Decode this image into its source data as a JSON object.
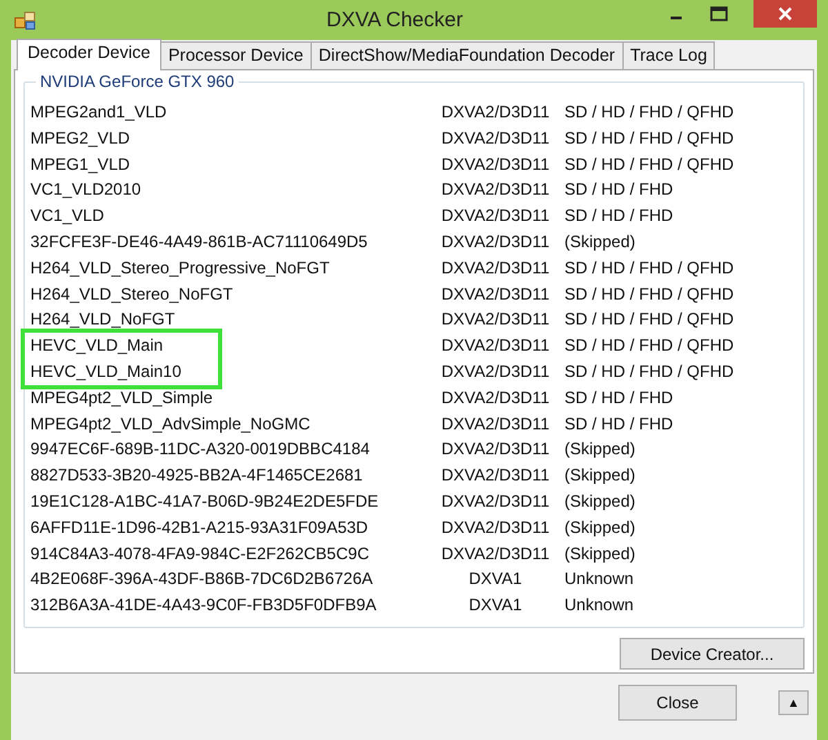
{
  "window": {
    "title": "DXVA Checker"
  },
  "tabs": [
    {
      "label": "Decoder Device",
      "selected": true
    },
    {
      "label": "Processor Device",
      "selected": false
    },
    {
      "label": "DirectShow/MediaFoundation Decoder",
      "selected": false
    },
    {
      "label": "Trace Log",
      "selected": false
    }
  ],
  "group": {
    "title": "NVIDIA GeForce GTX 960"
  },
  "rows": [
    {
      "name": "MPEG2and1_VLD",
      "api": "DXVA2/D3D11",
      "resolutions": "SD / HD / FHD / QFHD",
      "highlighted": false
    },
    {
      "name": "MPEG2_VLD",
      "api": "DXVA2/D3D11",
      "resolutions": "SD / HD / FHD / QFHD",
      "highlighted": false
    },
    {
      "name": "MPEG1_VLD",
      "api": "DXVA2/D3D11",
      "resolutions": "SD / HD / FHD / QFHD",
      "highlighted": false
    },
    {
      "name": "VC1_VLD2010",
      "api": "DXVA2/D3D11",
      "resolutions": "SD / HD / FHD",
      "highlighted": false
    },
    {
      "name": "VC1_VLD",
      "api": "DXVA2/D3D11",
      "resolutions": "SD / HD / FHD",
      "highlighted": false
    },
    {
      "name": "32FCFE3F-DE46-4A49-861B-AC71110649D5",
      "api": "DXVA2/D3D11",
      "resolutions": "(Skipped)",
      "highlighted": false
    },
    {
      "name": "H264_VLD_Stereo_Progressive_NoFGT",
      "api": "DXVA2/D3D11",
      "resolutions": "SD / HD / FHD / QFHD",
      "highlighted": false
    },
    {
      "name": "H264_VLD_Stereo_NoFGT",
      "api": "DXVA2/D3D11",
      "resolutions": "SD / HD / FHD / QFHD",
      "highlighted": false
    },
    {
      "name": "H264_VLD_NoFGT",
      "api": "DXVA2/D3D11",
      "resolutions": "SD / HD / FHD / QFHD",
      "highlighted": false
    },
    {
      "name": "HEVC_VLD_Main",
      "api": "DXVA2/D3D11",
      "resolutions": "SD / HD / FHD / QFHD",
      "highlighted": true
    },
    {
      "name": "HEVC_VLD_Main10",
      "api": "DXVA2/D3D11",
      "resolutions": "SD / HD / FHD / QFHD",
      "highlighted": true
    },
    {
      "name": "MPEG4pt2_VLD_Simple",
      "api": "DXVA2/D3D11",
      "resolutions": "SD / HD / FHD",
      "highlighted": false
    },
    {
      "name": "MPEG4pt2_VLD_AdvSimple_NoGMC",
      "api": "DXVA2/D3D11",
      "resolutions": "SD / HD / FHD",
      "highlighted": false
    },
    {
      "name": "9947EC6F-689B-11DC-A320-0019DBBC4184",
      "api": "DXVA2/D3D11",
      "resolutions": "(Skipped)",
      "highlighted": false
    },
    {
      "name": "8827D533-3B20-4925-BB2A-4F1465CE2681",
      "api": "DXVA2/D3D11",
      "resolutions": "(Skipped)",
      "highlighted": false
    },
    {
      "name": "19E1C128-A1BC-41A7-B06D-9B24E2DE5FDE",
      "api": "DXVA2/D3D11",
      "resolutions": "(Skipped)",
      "highlighted": false
    },
    {
      "name": "6AFFD11E-1D96-42B1-A215-93A31F09A53D",
      "api": "DXVA2/D3D11",
      "resolutions": "(Skipped)",
      "highlighted": false
    },
    {
      "name": "914C84A3-4078-4FA9-984C-E2F262CB5C9C",
      "api": "DXVA2/D3D11",
      "resolutions": "(Skipped)",
      "highlighted": false
    },
    {
      "name": "4B2E068F-396A-43DF-B86B-7DC6D2B6726A",
      "api": "DXVA1",
      "resolutions": "Unknown",
      "highlighted": false
    },
    {
      "name": "312B6A3A-41DE-4A43-9C0F-FB3D5F0DFB9A",
      "api": "DXVA1",
      "resolutions": "Unknown",
      "highlighted": false
    }
  ],
  "buttons": {
    "device_creator": "Device Creator...",
    "close": "Close",
    "expand": "▲"
  }
}
